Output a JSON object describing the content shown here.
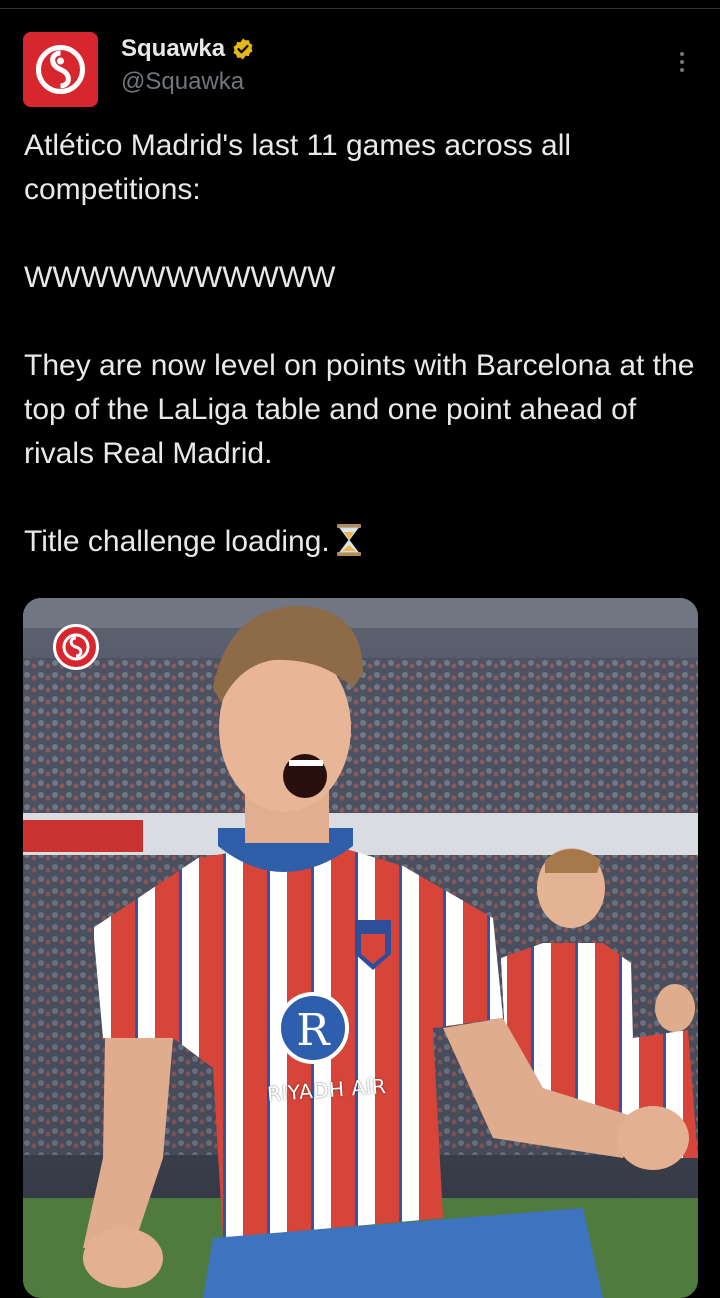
{
  "author": {
    "display_name": "Squawka",
    "handle": "@Squawka",
    "verified_badge_icon": "gold-verified-badge-icon",
    "avatar_icon": "squawka-logo-icon"
  },
  "menu": {
    "icon": "more-options-icon"
  },
  "tweet": {
    "line1": "Atlético Madrid's last 11 games across all competitions:",
    "results": "WWWWWWWWWWW",
    "line3": "They are now level on points with Barcelona at the top of the LaLiga table and one point ahead of rivals Real Madrid.",
    "line4": "Title challenge loading.",
    "emoji_icon": "hourglass-icon"
  },
  "media": {
    "sponsor_text": "RIYADH AIR",
    "watermark_icon": "squawka-logo-icon"
  },
  "colors": {
    "background": "#000000",
    "text": "#e7e9ea",
    "secondary_text": "#71767b",
    "brand_red": "#d7262e",
    "verified_gold": "#e2b719"
  }
}
